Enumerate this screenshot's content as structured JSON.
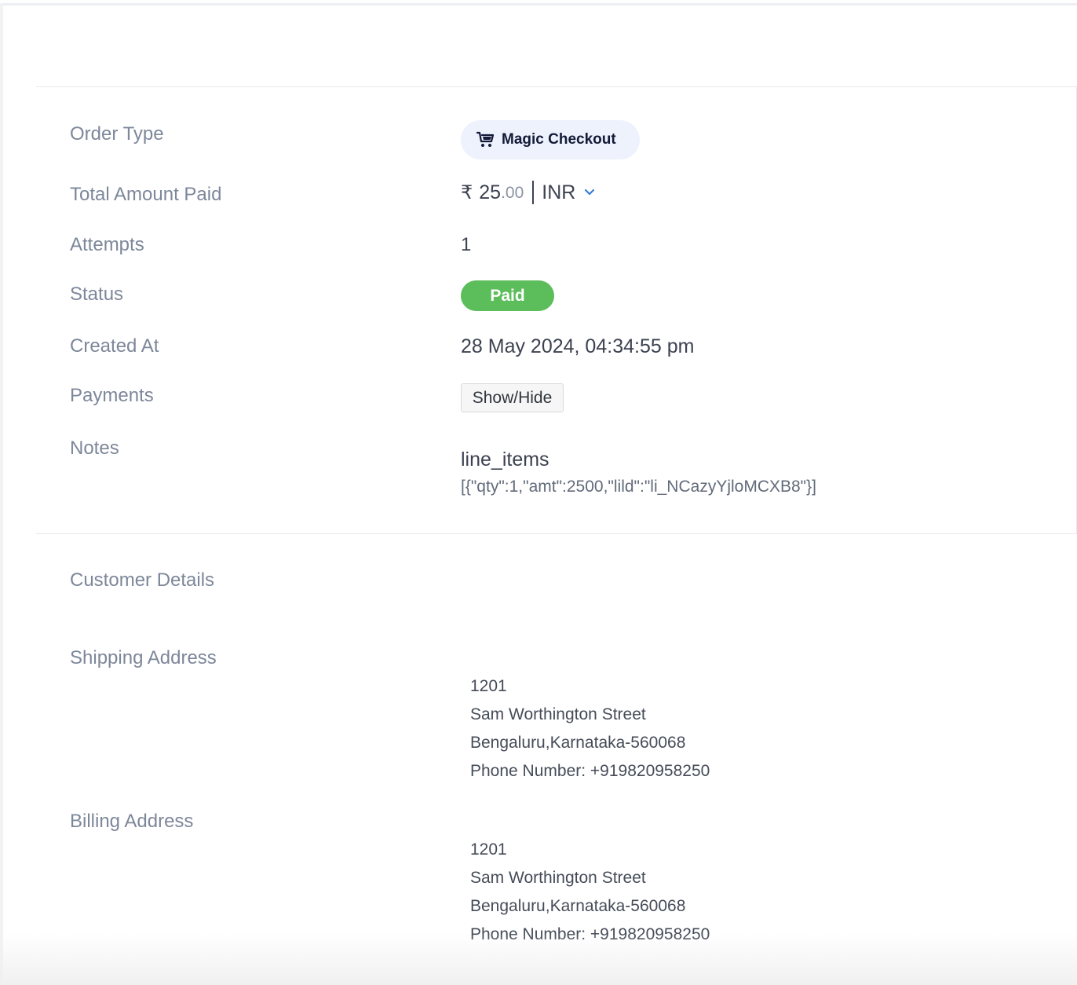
{
  "order": {
    "order_type": {
      "label": "Order Type",
      "value": "Magic Checkout",
      "icon": "shopping-cart-icon"
    },
    "total_amount": {
      "label": "Total Amount Paid",
      "currency_symbol": "₹",
      "whole": "25",
      "decimal": ".00",
      "currency": "INR"
    },
    "attempts": {
      "label": "Attempts",
      "value": "1"
    },
    "status": {
      "label": "Status",
      "value": "Paid",
      "color": "#5cbd5b"
    },
    "created_at": {
      "label": "Created At",
      "value": "28 May 2024, 04:34:55 pm"
    },
    "payments": {
      "label": "Payments",
      "button": "Show/Hide"
    },
    "notes": {
      "label": "Notes",
      "key": "line_items",
      "value": "[{\"qty\":1,\"amt\":2500,\"lild\":\"li_NCazyYjloMCXB8\"}]"
    }
  },
  "customer": {
    "section_title": "Customer Details",
    "shipping": {
      "label": "Shipping Address",
      "lines": [
        "1201",
        "Sam Worthington Street",
        "Bengaluru,Karnataka-560068",
        "Phone Number: +919820958250"
      ]
    },
    "billing": {
      "label": "Billing Address",
      "lines": [
        "1201",
        "Sam Worthington Street",
        "Bengaluru,Karnataka-560068",
        "Phone Number: +919820958250"
      ]
    }
  },
  "colors": {
    "label_text": "#7d879a",
    "value_text": "#3c4250",
    "pill_bg": "#edf2fd",
    "accent_blue": "#3a7bd5"
  }
}
